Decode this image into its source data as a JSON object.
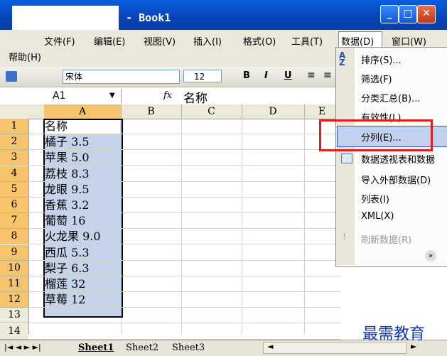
{
  "window": {
    "title": "el - Book1"
  },
  "menubar": {
    "items": [
      "文件(F)",
      "编辑(E)",
      "视图(V)",
      "插入(I)",
      "格式(O)",
      "工具(T)",
      "数据(D)",
      "窗口(W)",
      "帮助(H)"
    ]
  },
  "toolbar": {
    "font_name": "宋体",
    "font_size": "12",
    "bold": "B",
    "italic": "I",
    "underline": "U"
  },
  "formula": {
    "cell_ref": "A1",
    "fx": "fx",
    "value": "名称"
  },
  "columns": [
    "A",
    "B",
    "C",
    "D",
    "E"
  ],
  "rows": [
    "1",
    "2",
    "3",
    "4",
    "5",
    "6",
    "7",
    "8",
    "9",
    "10",
    "11",
    "12",
    "13",
    "14"
  ],
  "cells": [
    "名称",
    "橘子 3.5",
    "苹果 5.0",
    "荔枝 8.3",
    "龙眼 9.5",
    "香蕉 3.2",
    "葡萄 16",
    "火龙果 9.0",
    "西瓜 5.3",
    "梨子 6.3",
    "榴莲 32",
    "草莓 12"
  ],
  "data_menu": {
    "items": [
      {
        "label": "排序(S)...",
        "icon": "sort-az-icon"
      },
      {
        "label": "筛选(F)"
      },
      {
        "label": "分类汇总(B)..."
      },
      {
        "label": "有效性(L)..."
      },
      {
        "label": "分列(E)..."
      },
      {
        "label": "数据透视表和数据",
        "icon": "pivot-table-icon"
      },
      {
        "label": "导入外部数据(D)"
      },
      {
        "label": "列表(I)"
      },
      {
        "label": "XML(X)"
      },
      {
        "label": "刷新数据(R)",
        "icon": "refresh-icon",
        "disabled": true
      }
    ]
  },
  "sheets": [
    "Sheet1",
    "Sheet2",
    "Sheet3"
  ],
  "watermark": "最需教育",
  "colors": {
    "titlebar": "#0844b8",
    "highlight": "#e01e1e",
    "selection": "#c5d3ea"
  }
}
